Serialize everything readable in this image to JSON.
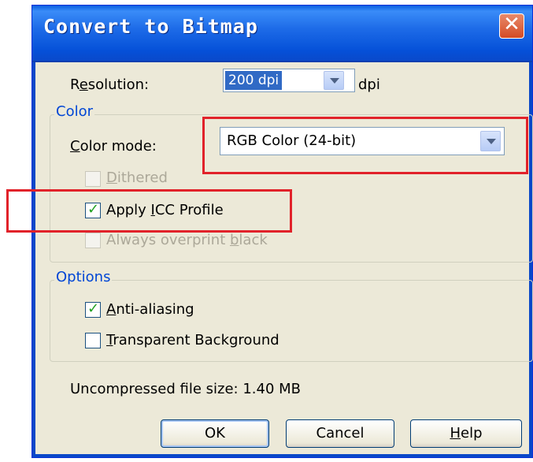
{
  "dialog": {
    "title": "Convert to Bitmap",
    "close_symbol": "✕"
  },
  "resolution": {
    "label_pre": "R",
    "label_accel": "e",
    "label_post": "solution:",
    "value": "200 dpi",
    "unit": "dpi"
  },
  "color_group": {
    "legend": "Color",
    "mode_label_accel": "C",
    "mode_label_post": "olor mode:",
    "mode_value": "RGB Color (24-bit)",
    "dithered": {
      "accel": "D",
      "label_post": "ithered",
      "checked": false,
      "enabled": false
    },
    "apply_icc": {
      "label_pre": "Apply ",
      "accel": "I",
      "label_post": "CC Profile",
      "checked": true,
      "enabled": true
    },
    "overprint": {
      "label_pre": "Always overprint ",
      "accel": "b",
      "label_post": "lack",
      "checked": false,
      "enabled": false
    }
  },
  "options_group": {
    "legend": "Options",
    "antialias": {
      "accel": "A",
      "label_post": "nti-aliasing",
      "checked": true
    },
    "transparent": {
      "accel": "T",
      "label_post": "ransparent Background",
      "checked": false
    }
  },
  "file_size_text": "Uncompressed file size: 1.40 MB",
  "buttons": {
    "ok": "OK",
    "cancel": "Cancel",
    "help_accel": "H",
    "help_post": "elp"
  },
  "colors": {
    "highlight": "#e1222a",
    "titlebar": "#0a5fe0",
    "check": "#21a121"
  }
}
